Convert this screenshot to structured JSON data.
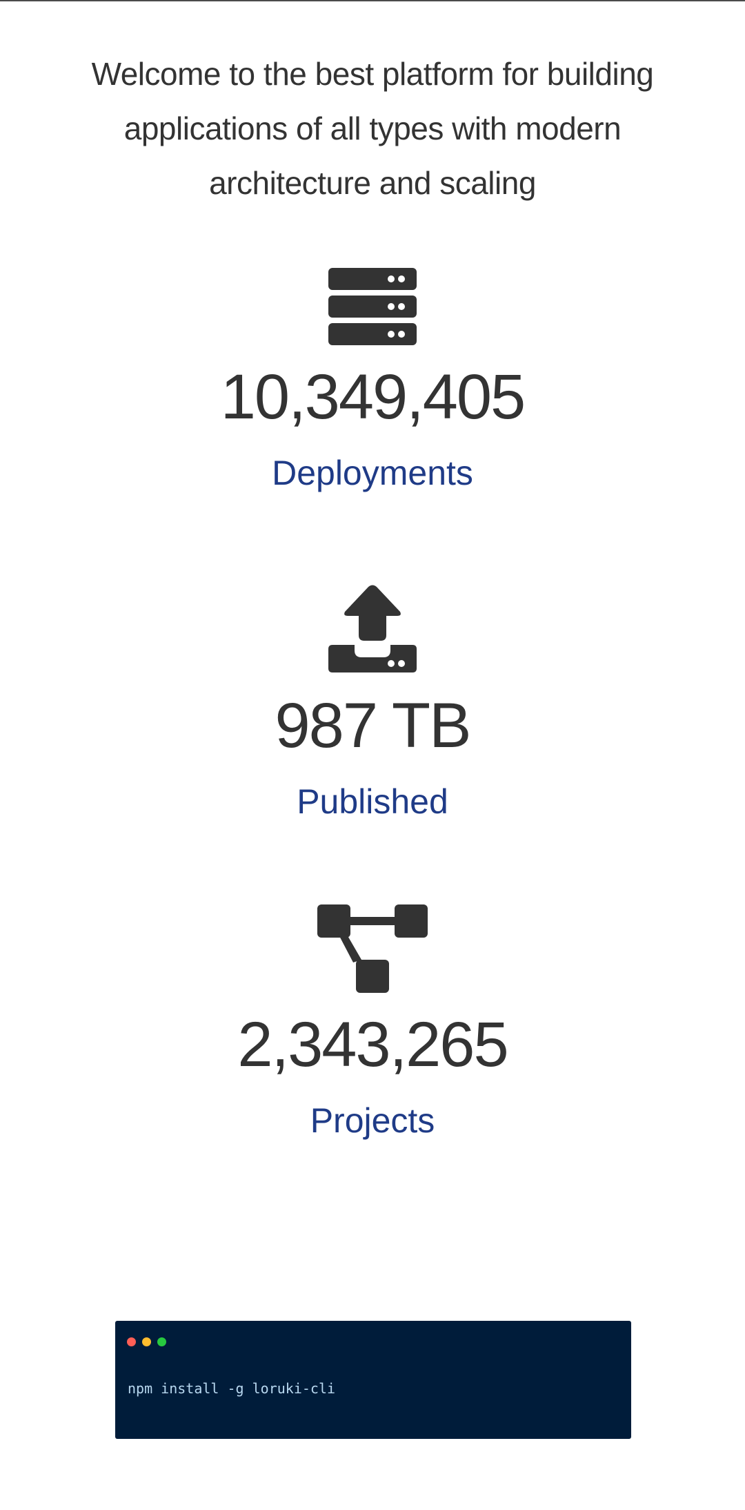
{
  "intro": {
    "headline": "Welcome to the best platform for building applications of all types with modern architecture and scaling"
  },
  "stats": [
    {
      "icon": "server-icon",
      "value": "10,349,405",
      "label": "Deployments"
    },
    {
      "icon": "upload-icon",
      "value": "987 TB",
      "label": "Published"
    },
    {
      "icon": "project-diagram-icon",
      "value": "2,343,265",
      "label": "Projects"
    }
  ],
  "terminal": {
    "command": "npm install -g loruki-cli"
  },
  "colors": {
    "text": "#333333",
    "label_accent": "#1f3b87",
    "terminal_bg": "#001c3a",
    "dot_red": "#ff5f56",
    "dot_yellow": "#ffbd2e",
    "dot_green": "#27c93f"
  }
}
